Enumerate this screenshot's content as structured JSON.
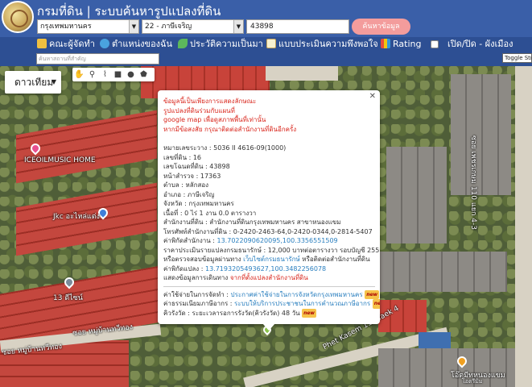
{
  "header": {
    "title": "กรมที่ดิน | ระบบค้นหารูปแปลงที่ดิน",
    "province": "กรุงเทพมหานคร",
    "amphoe": "22 - ภาษีเจริญ",
    "parcel_no": "43898",
    "search_label": "ค้นหาข้อมูล"
  },
  "menu": {
    "items": [
      {
        "label": "คณะผู้จัดทำ",
        "icon": "people-icon"
      },
      {
        "label": "ตำแหน่งของฉัน",
        "icon": "globe-icon"
      },
      {
        "label": "ประวัติความเป็นมา",
        "icon": "sprout-icon"
      },
      {
        "label": "แบบประเมินความพึงพอใจ",
        "icon": "form-icon"
      },
      {
        "label": "Rating",
        "icon": "chart-icon"
      },
      {
        "label": "เปิด/ปิด - ผังเมือง",
        "icon": "checkbox-icon"
      }
    ]
  },
  "subbar": {
    "search_placeholder": "ค้นหาสถานที่สำคัญ",
    "toggle_label": "Toggle Street"
  },
  "map": {
    "type_label": "ดาวเทียม",
    "labels": {
      "iceoil": "ICEOILMUSIC HOME",
      "jkc": "Jkc อะไหล่แต่ง",
      "chutima": "13 ดีไซน์",
      "soi_left": "ซอย หมู่บ้านทวีทอง",
      "soi_left2": "ซอย หมู่บ้านทวีทอง",
      "phet_kasem": "Phet Kasem 110 Yaek 4",
      "phet_kasem_right": "ซอย เพชรเกษม 110 แยก 4-3",
      "market": "โอ๊ตมีทหนองแขม",
      "market_sub": "โอตรีมิม"
    }
  },
  "popup": {
    "warnings": [
      "ข้อมูลนี้เป็นเพียงการแสดงลักษณะ",
      "รูปแปลงที่ดินร่วมกับแผนที่",
      "google map เพื่อดูสภาพพื้นที่เท่านั้น",
      "หากมีข้อสงสัย กรุณาติดต่อสำนักงานที่ดินอีกครั้ง"
    ],
    "rows": [
      "หมายเลขระวาง : 5036 II 4616-09(1000)",
      "เลขที่ดิน : 16",
      "เลขโฉนดที่ดิน : 43898",
      "หน้าสำรวจ : 17363",
      "ตำบล : หลักสอง",
      "อำเภอ : ภาษีเจริญ",
      "จังหวัด : กรุงเทพมหานคร",
      "เนื้อที่ : 0 ไร่ 1 งาน 0.0 ตารางวา",
      "สำนักงานที่ดิน : สำนักงานที่ดินกรุงเทพมหานคร สาขาหนองแขม",
      "โทรศัพท์สำนักงานที่ดิน : 0-2420-2463-64,0-2420-0344,0-2814-5407"
    ],
    "office_coord_label": "ค่าพิกัดสำนักงาน : ",
    "office_coord": "13.7022090620095,100.3356551509",
    "price_row": "ราคาประเมินรายแปลงกรมธนารักษ์ : 12,000 บาทต่อตารางวา รอบบัญชี 2559-2562",
    "check_prefix": "หรือตรวจสอบข้อมูลผ่านทาง ",
    "check_link": "เว็บไซต์กรมธนารักษ์",
    "check_suffix": " หรือติดต่อสำนักงานที่ดิน",
    "parcel_coord_label": "ค่าพิกัดแปลง : ",
    "parcel_coord": "13.7193205493627,100.3482256078",
    "show_prefix": "แสดงข้อมูลการเดินทาง ",
    "show_link": "จากที่ตั้งแปลงสำนักงานที่ดิน",
    "fee1_label": "ค่าใช้จ่ายในการจัดทำ : ",
    "fee1_link": "ประกาศค่าใช้จ่ายในการจังหวัดกรุงเทพมหานคร",
    "fee2_label": "ค่าธรรมเนียมภาษีอากร : ",
    "fee2_link": "ระบบให้บริการประชาชนในการคำนวณภาษีอากร",
    "fee3_label": "คิวรังวัด : ",
    "fee3_text": "ระยะเวลารอการรังวัด(คิวรังวัด) 48 วัน",
    "new_badge": "new"
  }
}
